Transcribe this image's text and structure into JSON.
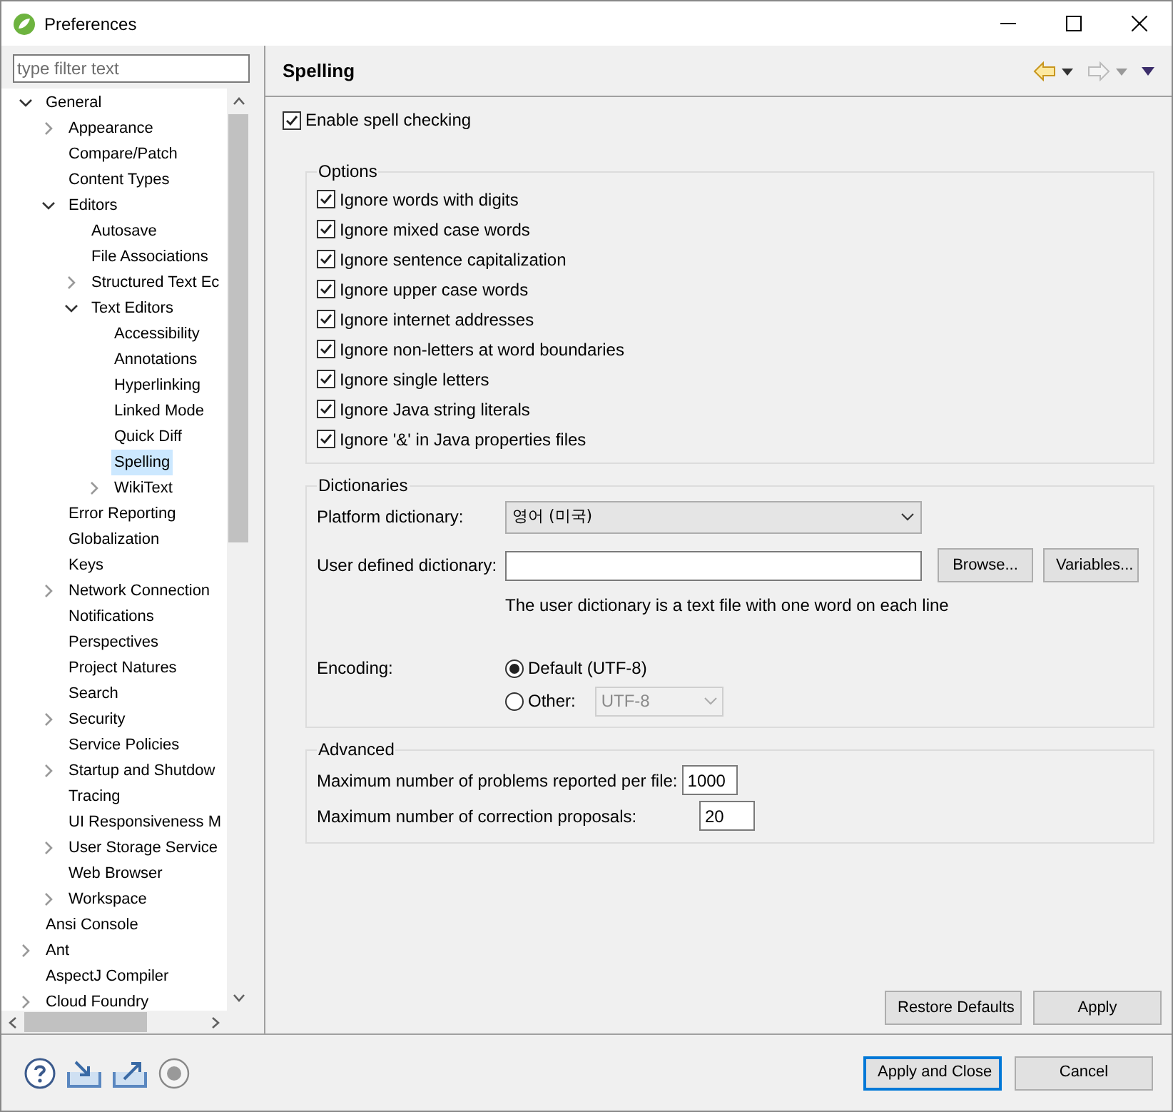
{
  "window": {
    "title": "Preferences"
  },
  "filter": {
    "placeholder": "type filter text"
  },
  "tree": [
    {
      "label": "General",
      "kind": "branch",
      "expanded": true,
      "selected": false,
      "children": [
        {
          "label": "Appearance",
          "kind": "branch",
          "expanded": false,
          "selected": false
        },
        {
          "label": "Compare/Patch",
          "kind": "leaf",
          "selected": false
        },
        {
          "label": "Content Types",
          "kind": "leaf",
          "selected": false
        },
        {
          "label": "Editors",
          "kind": "branch",
          "expanded": true,
          "selected": false,
          "children": [
            {
              "label": "Autosave",
              "kind": "leaf",
              "selected": false
            },
            {
              "label": "File Associations",
              "kind": "leaf",
              "selected": false
            },
            {
              "label": "Structured Text Ec",
              "kind": "branch",
              "expanded": false,
              "selected": false
            },
            {
              "label": "Text Editors",
              "kind": "branch",
              "expanded": true,
              "selected": false,
              "children": [
                {
                  "label": "Accessibility",
                  "kind": "leaf",
                  "selected": false
                },
                {
                  "label": "Annotations",
                  "kind": "leaf",
                  "selected": false
                },
                {
                  "label": "Hyperlinking",
                  "kind": "leaf",
                  "selected": false
                },
                {
                  "label": "Linked Mode",
                  "kind": "leaf",
                  "selected": false
                },
                {
                  "label": "Quick Diff",
                  "kind": "leaf",
                  "selected": false
                },
                {
                  "label": "Spelling",
                  "kind": "leaf",
                  "selected": true
                },
                {
                  "label": "WikiText",
                  "kind": "branch",
                  "expanded": false,
                  "selected": false
                }
              ]
            }
          ]
        },
        {
          "label": "Error Reporting",
          "kind": "leaf",
          "selected": false
        },
        {
          "label": "Globalization",
          "kind": "leaf",
          "selected": false
        },
        {
          "label": "Keys",
          "kind": "leaf",
          "selected": false
        },
        {
          "label": "Network Connection",
          "kind": "branch",
          "expanded": false,
          "selected": false
        },
        {
          "label": "Notifications",
          "kind": "leaf",
          "selected": false
        },
        {
          "label": "Perspectives",
          "kind": "leaf",
          "selected": false
        },
        {
          "label": "Project Natures",
          "kind": "leaf",
          "selected": false
        },
        {
          "label": "Search",
          "kind": "leaf",
          "selected": false
        },
        {
          "label": "Security",
          "kind": "branch",
          "expanded": false,
          "selected": false
        },
        {
          "label": "Service Policies",
          "kind": "leaf",
          "selected": false
        },
        {
          "label": "Startup and Shutdow",
          "kind": "branch",
          "expanded": false,
          "selected": false
        },
        {
          "label": "Tracing",
          "kind": "leaf",
          "selected": false
        },
        {
          "label": "UI Responsiveness M",
          "kind": "leaf",
          "selected": false
        },
        {
          "label": "User Storage Service",
          "kind": "branch",
          "expanded": false,
          "selected": false
        },
        {
          "label": "Web Browser",
          "kind": "leaf",
          "selected": false
        },
        {
          "label": "Workspace",
          "kind": "branch",
          "expanded": false,
          "selected": false
        }
      ]
    },
    {
      "label": "Ansi Console",
      "kind": "leaf",
      "selected": false
    },
    {
      "label": "Ant",
      "kind": "branch",
      "expanded": false,
      "selected": false
    },
    {
      "label": "AspectJ Compiler",
      "kind": "leaf",
      "selected": false
    },
    {
      "label": "Cloud Foundry",
      "kind": "branch",
      "expanded": false,
      "selected": false
    }
  ],
  "page": {
    "title": "Spelling",
    "enable": {
      "label": "Enable spell checking",
      "checked": true
    },
    "options": {
      "title": "Options",
      "items": [
        {
          "label": "Ignore words with digits",
          "checked": true
        },
        {
          "label": "Ignore mixed case words",
          "checked": true
        },
        {
          "label": "Ignore sentence capitalization",
          "checked": true
        },
        {
          "label": "Ignore upper case words",
          "checked": true
        },
        {
          "label": "Ignore internet addresses",
          "checked": true
        },
        {
          "label": "Ignore non-letters at word boundaries",
          "checked": true
        },
        {
          "label": "Ignore single letters",
          "checked": true
        },
        {
          "label": "Ignore Java string literals",
          "checked": true
        },
        {
          "label": "Ignore '&' in Java properties files",
          "checked": true
        }
      ]
    },
    "dictionaries": {
      "title": "Dictionaries",
      "platform_label": "Platform dictionary:",
      "platform_value": "영어 (미국)",
      "user_label": "User defined dictionary:",
      "browse": "Browse...",
      "variables": "Variables...",
      "hint": "The user dictionary is a text file with one word on each line",
      "encoding_label": "Encoding:",
      "encodings": [
        {
          "label": "Default (UTF-8)",
          "selected": true
        },
        {
          "label": "Other:",
          "selected": false
        }
      ],
      "other_value": "UTF-8"
    },
    "advanced": {
      "title": "Advanced",
      "fields": [
        {
          "label": "Maximum number of problems reported per file:",
          "value": "1000"
        },
        {
          "label": "Maximum number of correction proposals:",
          "value": "20"
        }
      ]
    },
    "buttons": [
      "Restore Defaults",
      "Apply"
    ]
  },
  "footer": {
    "buttons": [
      {
        "label": "Apply and Close",
        "default": true
      },
      {
        "label": "Cancel",
        "default": false
      }
    ]
  }
}
